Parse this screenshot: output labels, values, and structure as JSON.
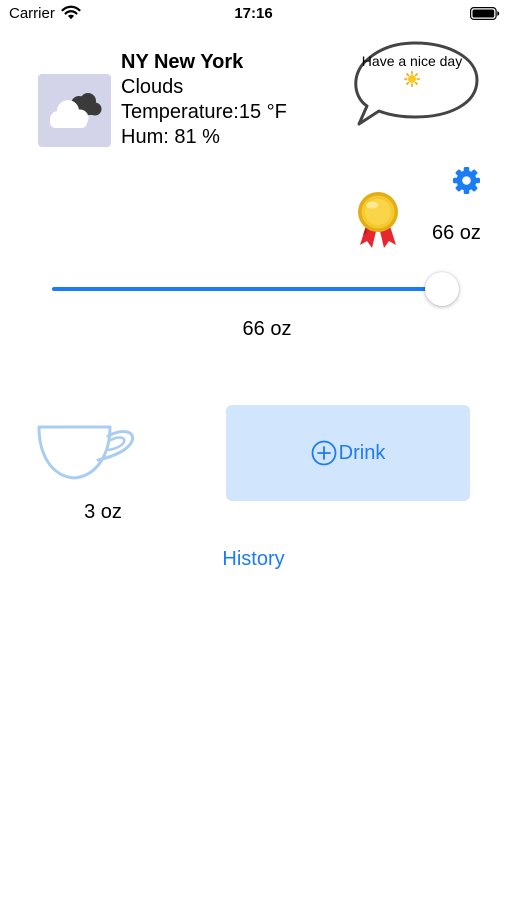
{
  "status_bar": {
    "carrier": "Carrier",
    "time": "17:16"
  },
  "weather": {
    "city": "NY New York",
    "condition": "Clouds",
    "temperature": "Temperature:15 °F",
    "humidity": "Hum:  81 %",
    "icon": "cloud-icon"
  },
  "bubble": {
    "text": "Have a nice day",
    "icon": "sun-icon"
  },
  "goal": {
    "label": "66 oz"
  },
  "slider": {
    "value": 66,
    "max": 66,
    "value_label": "66 oz"
  },
  "cup": {
    "label": "3 oz"
  },
  "drink_button": {
    "label": "Drink"
  },
  "history_link": {
    "label": "History"
  },
  "colors": {
    "accent": "#1c7cf4",
    "button_bg": "#d1e5fc",
    "cup": "#a9cdf0",
    "weather_bg": "#d3d4e9"
  }
}
